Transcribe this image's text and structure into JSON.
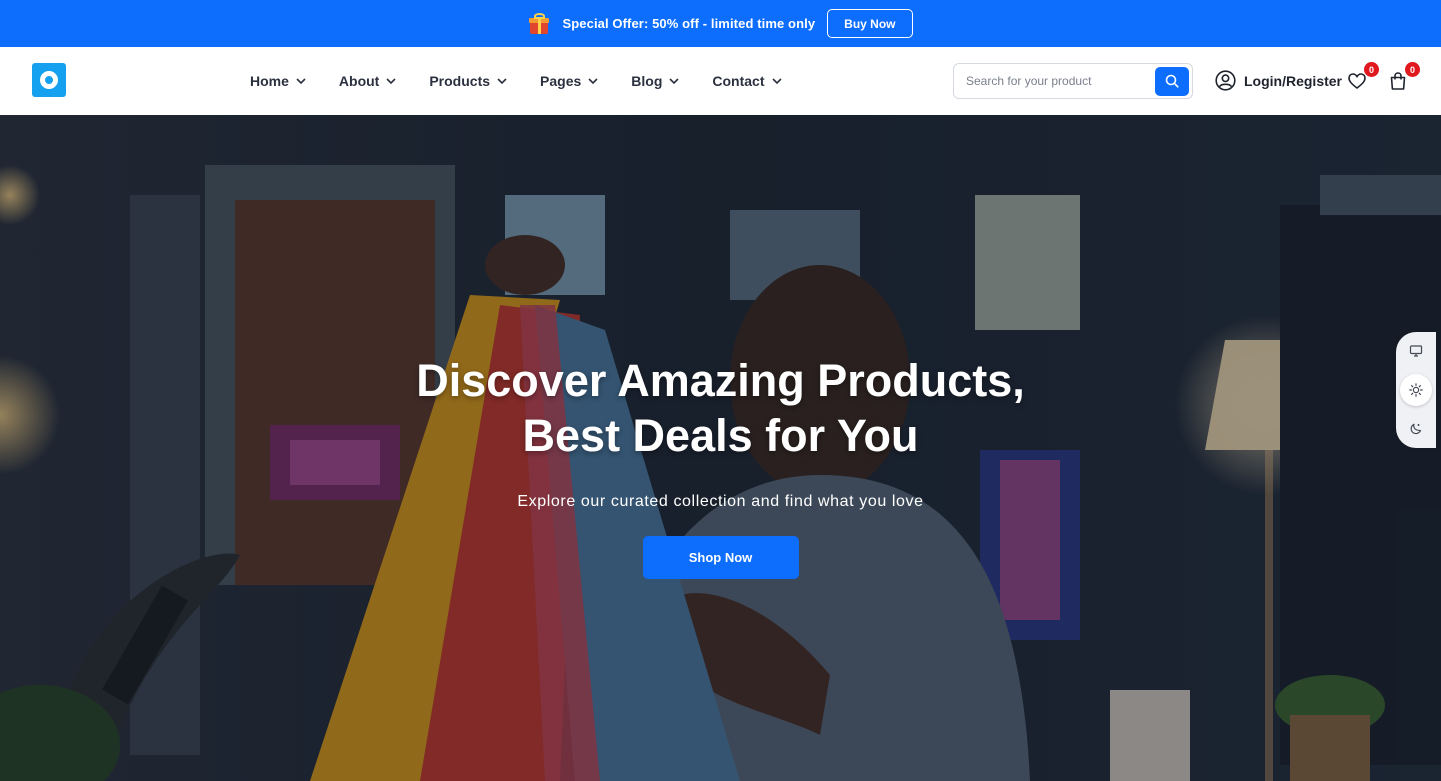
{
  "promo": {
    "text": "Special Offer: 50% off - limited time only",
    "button_label": "Buy Now",
    "icon": "gift-icon"
  },
  "header": {
    "logo_icon": "ring-logo-icon",
    "nav": [
      {
        "label": "Home"
      },
      {
        "label": "About"
      },
      {
        "label": "Products"
      },
      {
        "label": "Pages"
      },
      {
        "label": "Blog"
      },
      {
        "label": "Contact"
      }
    ],
    "search": {
      "placeholder": "Search for your product",
      "icon": "search-icon"
    },
    "account_label": "Login/Register",
    "wishlist_count": "0",
    "cart_count": "0"
  },
  "hero": {
    "title_line1": "Discover Amazing Products,",
    "title_line2": "Best Deals for You",
    "subtitle": "Explore our curated collection and find what you love",
    "cta_label": "Shop Now"
  },
  "theme_switcher": {
    "options": [
      "monitor-icon",
      "sun-icon",
      "moon-icon"
    ],
    "active": "sun-icon"
  },
  "colors": {
    "primary": "#0d6efd",
    "logo": "#16a0f0",
    "badge": "#e0191f"
  }
}
